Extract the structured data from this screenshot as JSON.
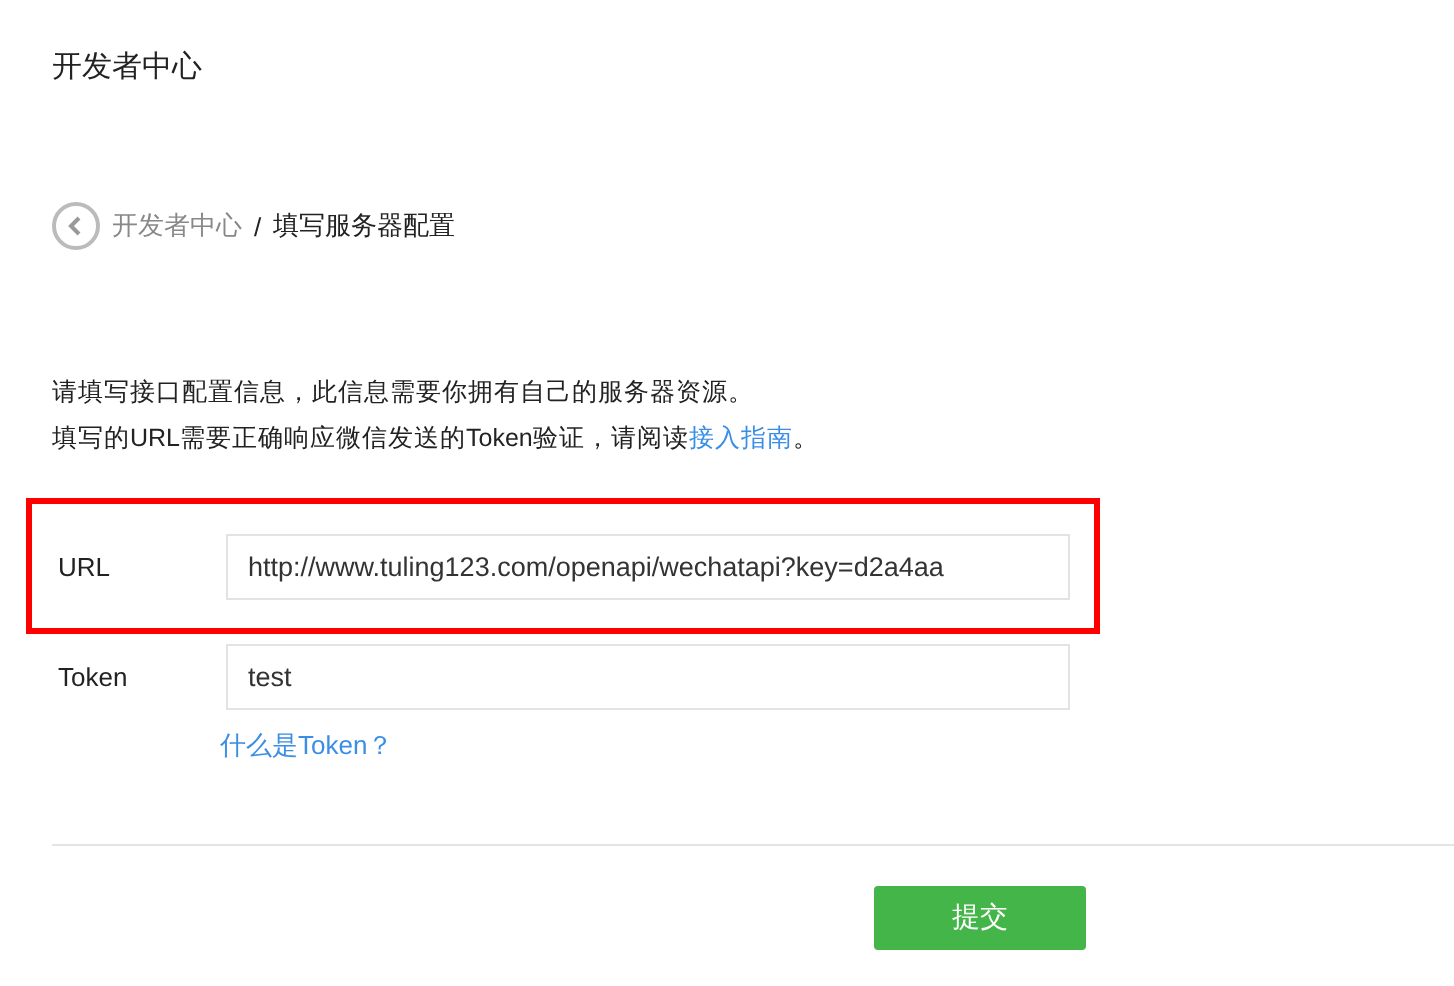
{
  "page_title": "开发者中心",
  "breadcrumb": {
    "parent": "开发者中心",
    "separator": "/",
    "current": "填写服务器配置"
  },
  "intro": {
    "line_1": "请填写接口配置信息，此信息需要你拥有自己的服务器资源。",
    "line_2": "填写的URL需要正确响应微信发送的Token验证，请阅读",
    "link": "接入指南",
    "line_2_end": "。"
  },
  "fields": [
    {
      "label": "URL",
      "value": "http://www.tuling123.com/openapi/wechatapi?key=d2a4aa",
      "highlighted": true
    },
    {
      "label": "Token",
      "value": "test",
      "highlighted": false,
      "help_link": "什么是Token？"
    }
  ],
  "submit_button": "提交"
}
